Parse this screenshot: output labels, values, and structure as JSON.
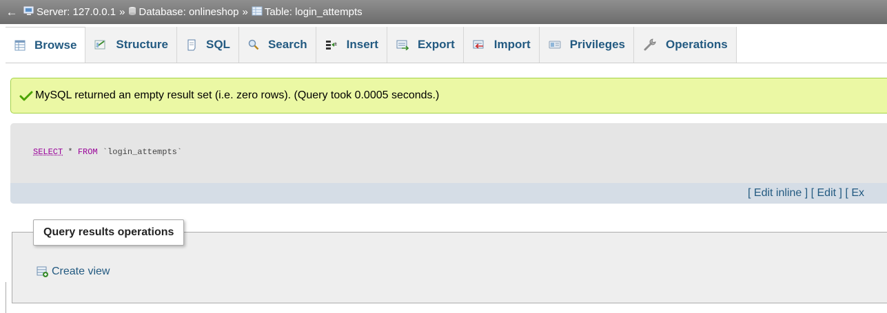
{
  "breadcrumb": {
    "back_icon": "arrow-left-icon",
    "server_label": "Server: 127.0.0.1",
    "database_label": "Database: onlineshop",
    "table_label": "Table: login_attempts",
    "separator": "»"
  },
  "tabs": [
    {
      "label": "Browse",
      "icon": "browse-table-icon",
      "active": true
    },
    {
      "label": "Structure",
      "icon": "structure-icon",
      "active": false
    },
    {
      "label": "SQL",
      "icon": "sql-document-icon",
      "active": false
    },
    {
      "label": "Search",
      "icon": "magnifier-icon",
      "active": false
    },
    {
      "label": "Insert",
      "icon": "insert-row-icon",
      "active": false
    },
    {
      "label": "Export",
      "icon": "export-icon",
      "active": false
    },
    {
      "label": "Import",
      "icon": "import-icon",
      "active": false
    },
    {
      "label": "Privileges",
      "icon": "privileges-icon",
      "active": false
    },
    {
      "label": "Operations",
      "icon": "wrench-icon",
      "active": false
    }
  ],
  "message": {
    "text": "MySQL returned an empty result set (i.e. zero rows). (Query took 0.0005 seconds.)",
    "icon": "check-icon"
  },
  "sql": {
    "keyword_select": "SELECT",
    "star": " * ",
    "keyword_from": "FROM",
    "table": " `login_attempts`"
  },
  "sql_links": {
    "edit_inline": "Edit inline",
    "edit": "Edit",
    "explain_partial": "Ex"
  },
  "query_ops": {
    "legend": "Query results operations",
    "create_view": "Create view"
  },
  "colors": {
    "link": "#235a81",
    "success_bg": "#ebf8a4",
    "success_border": "#a2d246",
    "sql_keyword": "#990099"
  }
}
